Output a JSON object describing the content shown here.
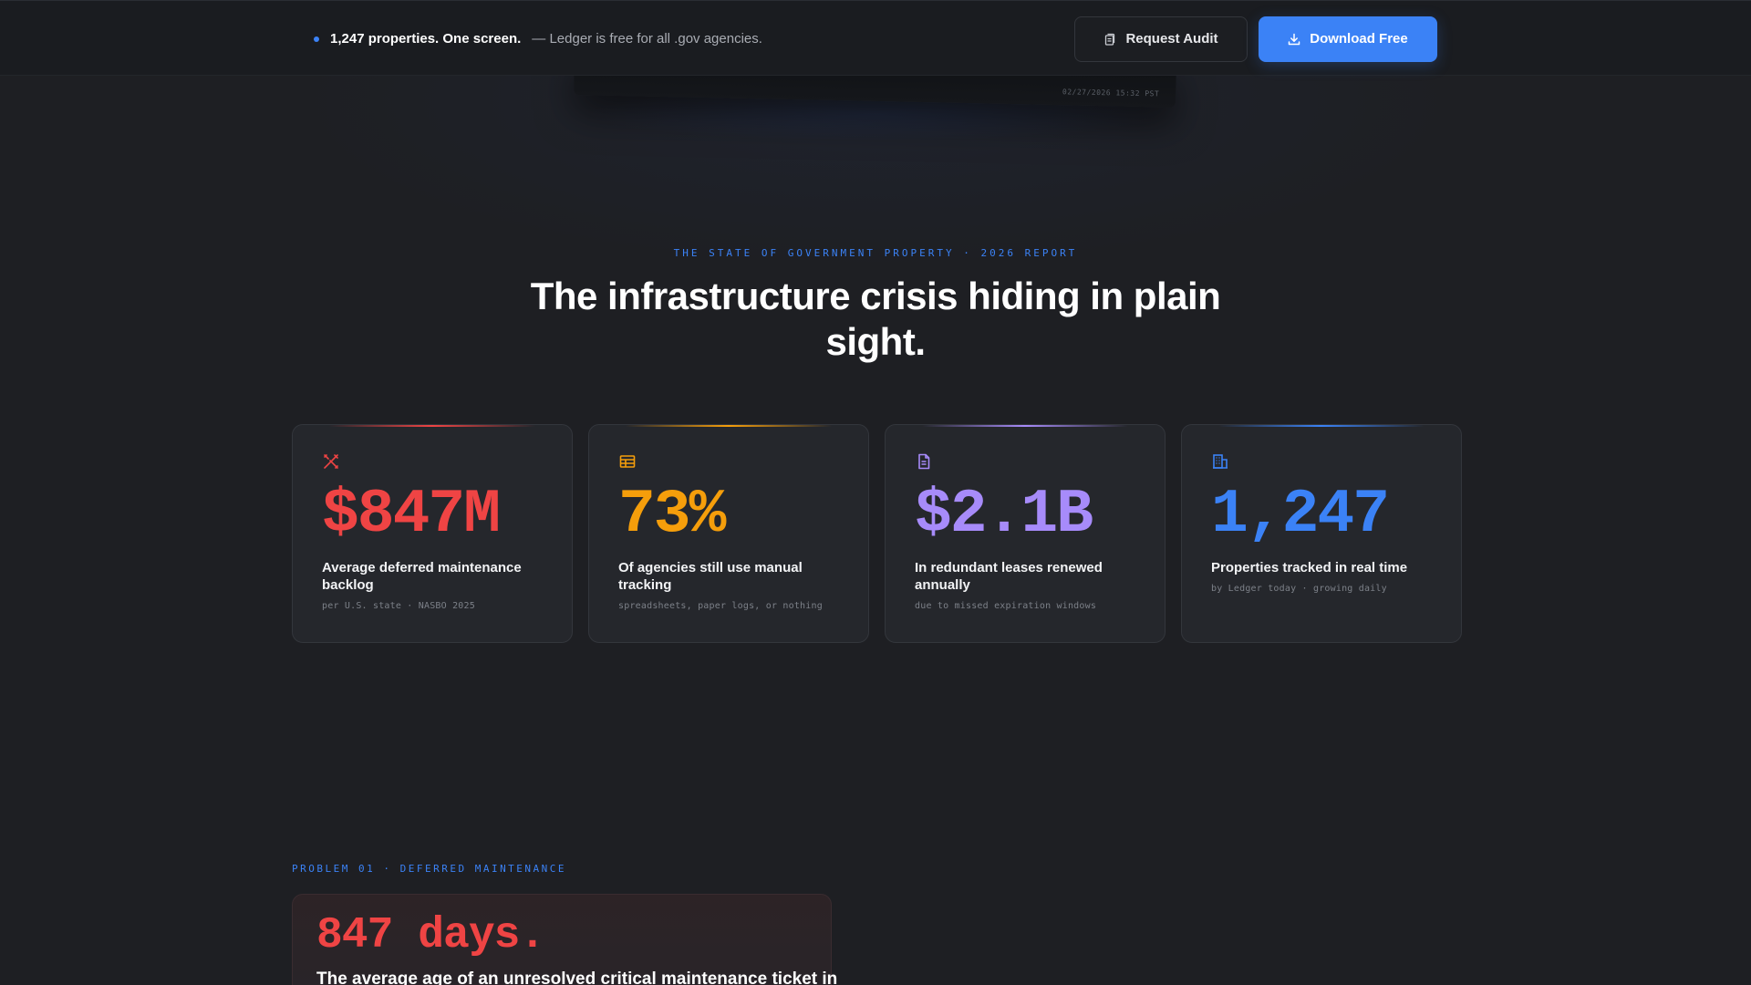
{
  "topbar": {
    "promo_strong": "1,247 properties. One screen.",
    "promo_rest": "— Ledger is free for all .gov agencies.",
    "request_audit_label": "Request Audit",
    "download_label": "Download Free"
  },
  "peek": {
    "timestamp": "02/27/2026 15:32 PST"
  },
  "hero": {
    "eyebrow": "THE STATE OF GOVERNMENT PROPERTY · 2026 REPORT",
    "headline": "The infrastructure crisis hiding in plain sight."
  },
  "stats": [
    {
      "icon": "tools-icon",
      "value": "$847M",
      "label": "Average deferred maintenance backlog",
      "sub": "per U.S. state · NASBO 2025",
      "color": "#ef4444"
    },
    {
      "icon": "spreadsheet-icon",
      "value": "73%",
      "label": "Of agencies still use manual tracking",
      "sub": "spreadsheets, paper logs, or nothing",
      "color": "#f59e0b"
    },
    {
      "icon": "document-icon",
      "value": "$2.1B",
      "label": "In redundant leases renewed annually",
      "sub": "due to missed expiration windows",
      "color": "#a78bfa"
    },
    {
      "icon": "building-icon",
      "value": "1,247",
      "label": "Properties tracked in real time",
      "sub": "by Ledger today · growing daily",
      "color": "#3b82f6"
    }
  ],
  "problem": {
    "eyebrow": "PROBLEM 01 · DEFERRED MAINTENANCE",
    "big": "847 days.",
    "text": "The average age of an unresolved critical maintenance ticket in"
  }
}
